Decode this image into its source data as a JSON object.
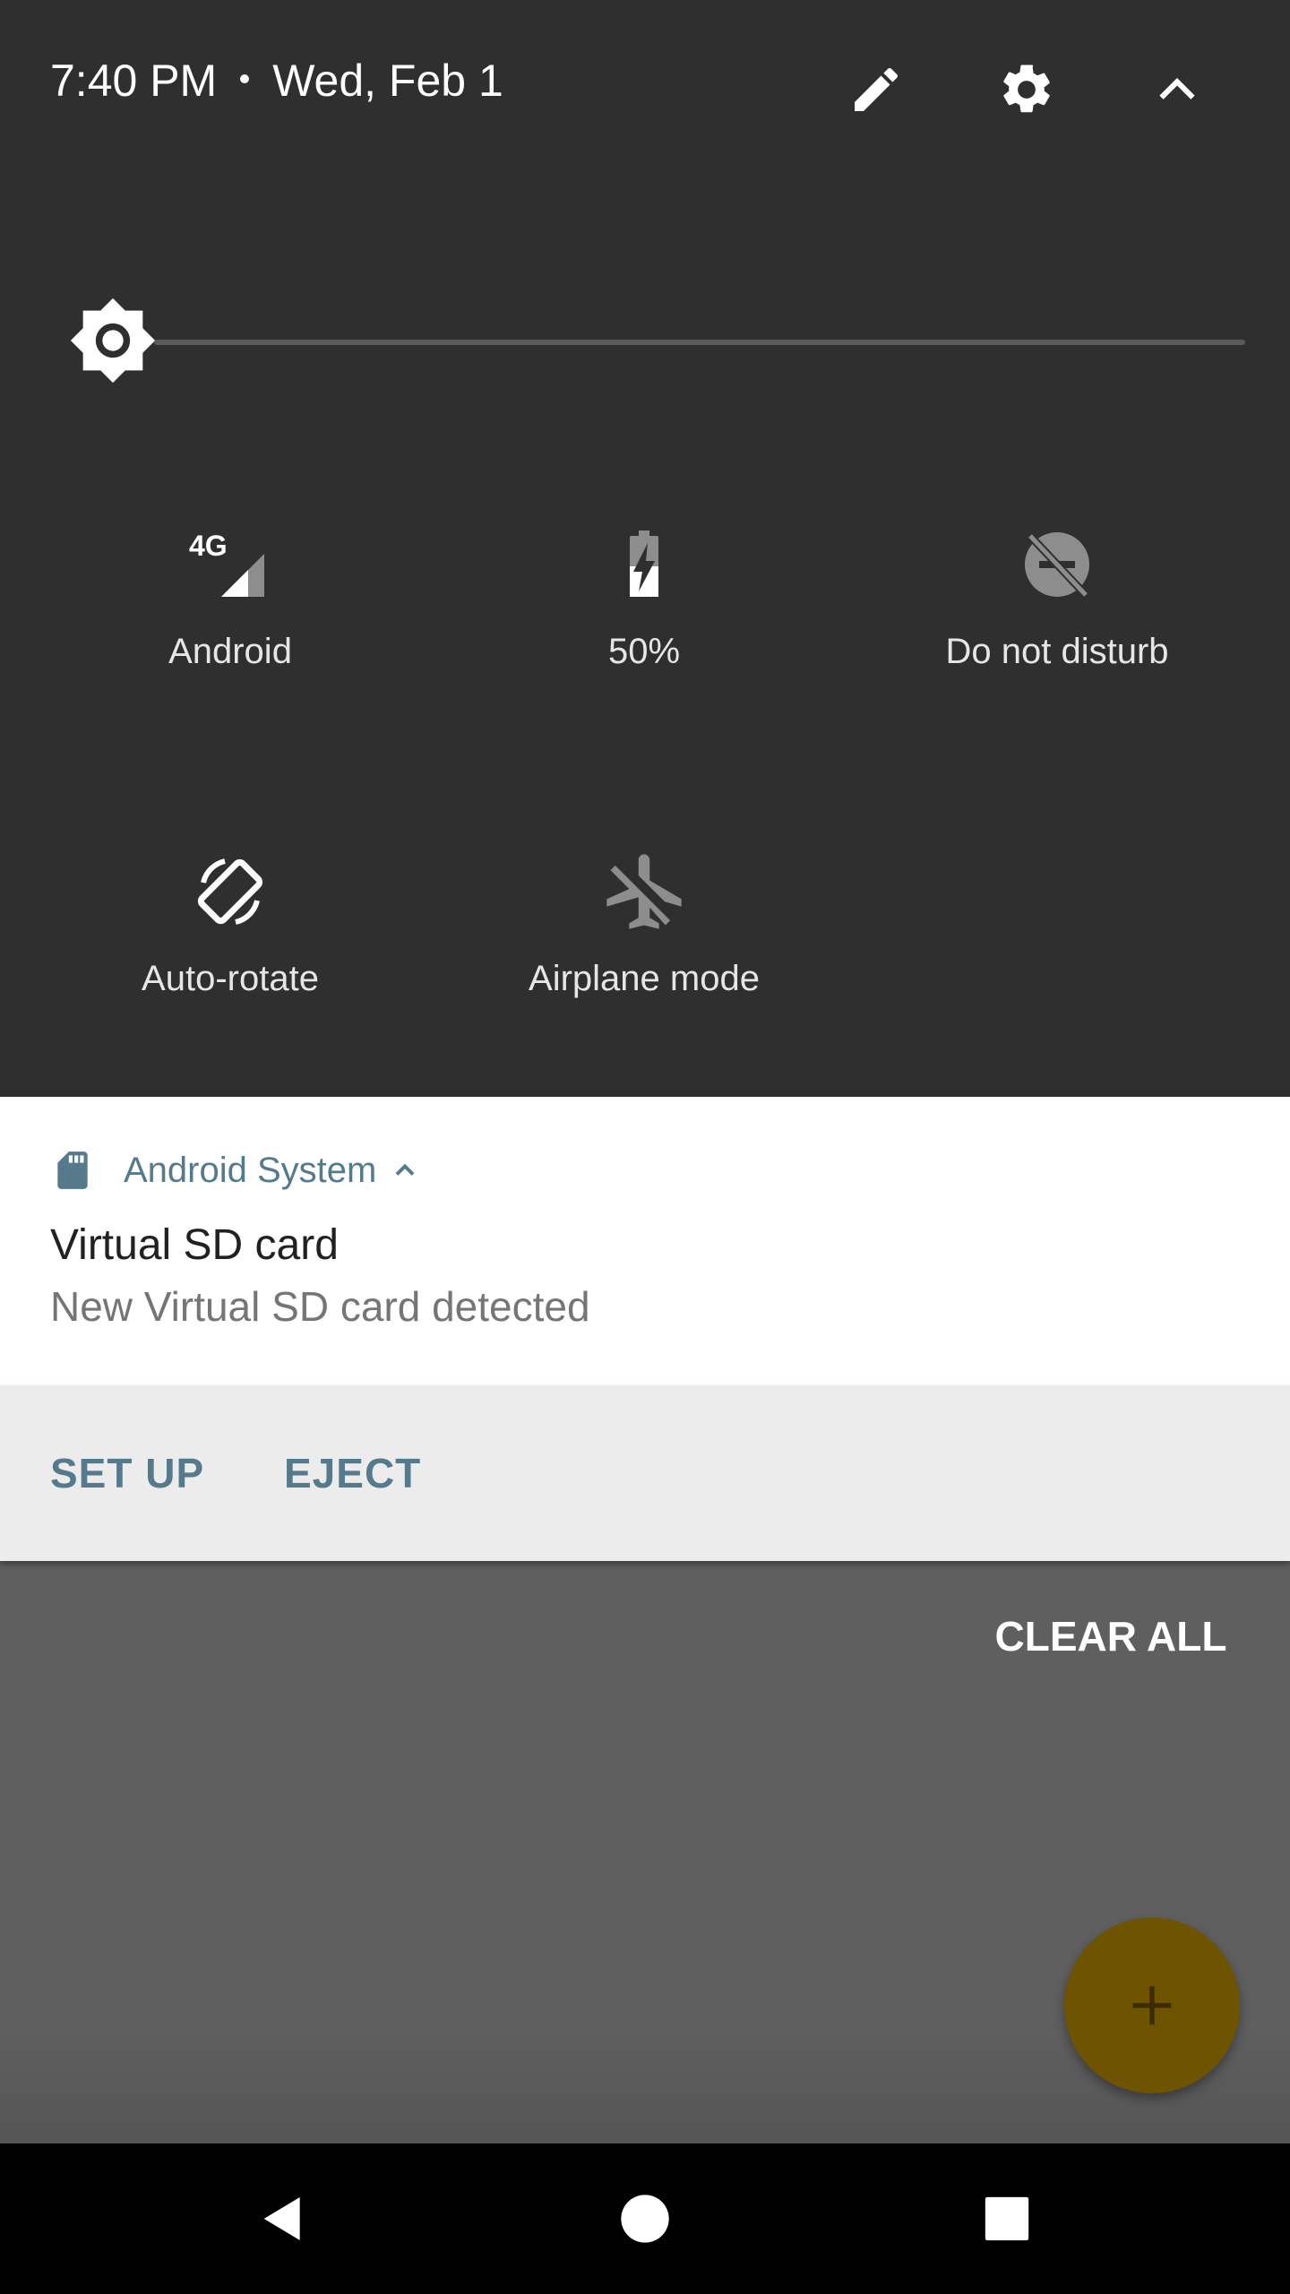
{
  "status": {
    "time": "7:40 PM",
    "date": "Wed, Feb 1"
  },
  "header_icons": {
    "edit": "pencil-icon",
    "settings": "gear-icon",
    "collapse": "chevron-up-icon"
  },
  "brightness": {
    "icon": "brightness-icon",
    "level": 0.0
  },
  "tiles": [
    {
      "label": "Android",
      "icon": "cellular-4g-icon",
      "active": true
    },
    {
      "label": "50%",
      "icon": "battery-charging-icon",
      "active": true
    },
    {
      "label": "Do not disturb",
      "icon": "do-not-disturb-off-icon",
      "active": false
    },
    {
      "label": "Auto-rotate",
      "icon": "auto-rotate-icon",
      "active": true
    },
    {
      "label": "Airplane mode",
      "icon": "airplane-off-icon",
      "active": false
    }
  ],
  "notification": {
    "app_icon": "sd-card-icon",
    "app_name": "Android System",
    "expand_icon": "chevron-up-icon",
    "title": "Virtual SD card",
    "text": "New Virtual SD card detected",
    "actions": [
      "SET UP",
      "EJECT"
    ]
  },
  "clear_all": "CLEAR ALL",
  "fab": {
    "icon": "plus-icon"
  },
  "navbar": {
    "back": "back-icon",
    "home": "home-icon",
    "recents": "recents-icon"
  },
  "colors": {
    "panel_bg": "#2f2f2f",
    "shade_bg": "#5f5f5f",
    "notif_accent": "#557a8c",
    "fab": "#6e5300"
  }
}
